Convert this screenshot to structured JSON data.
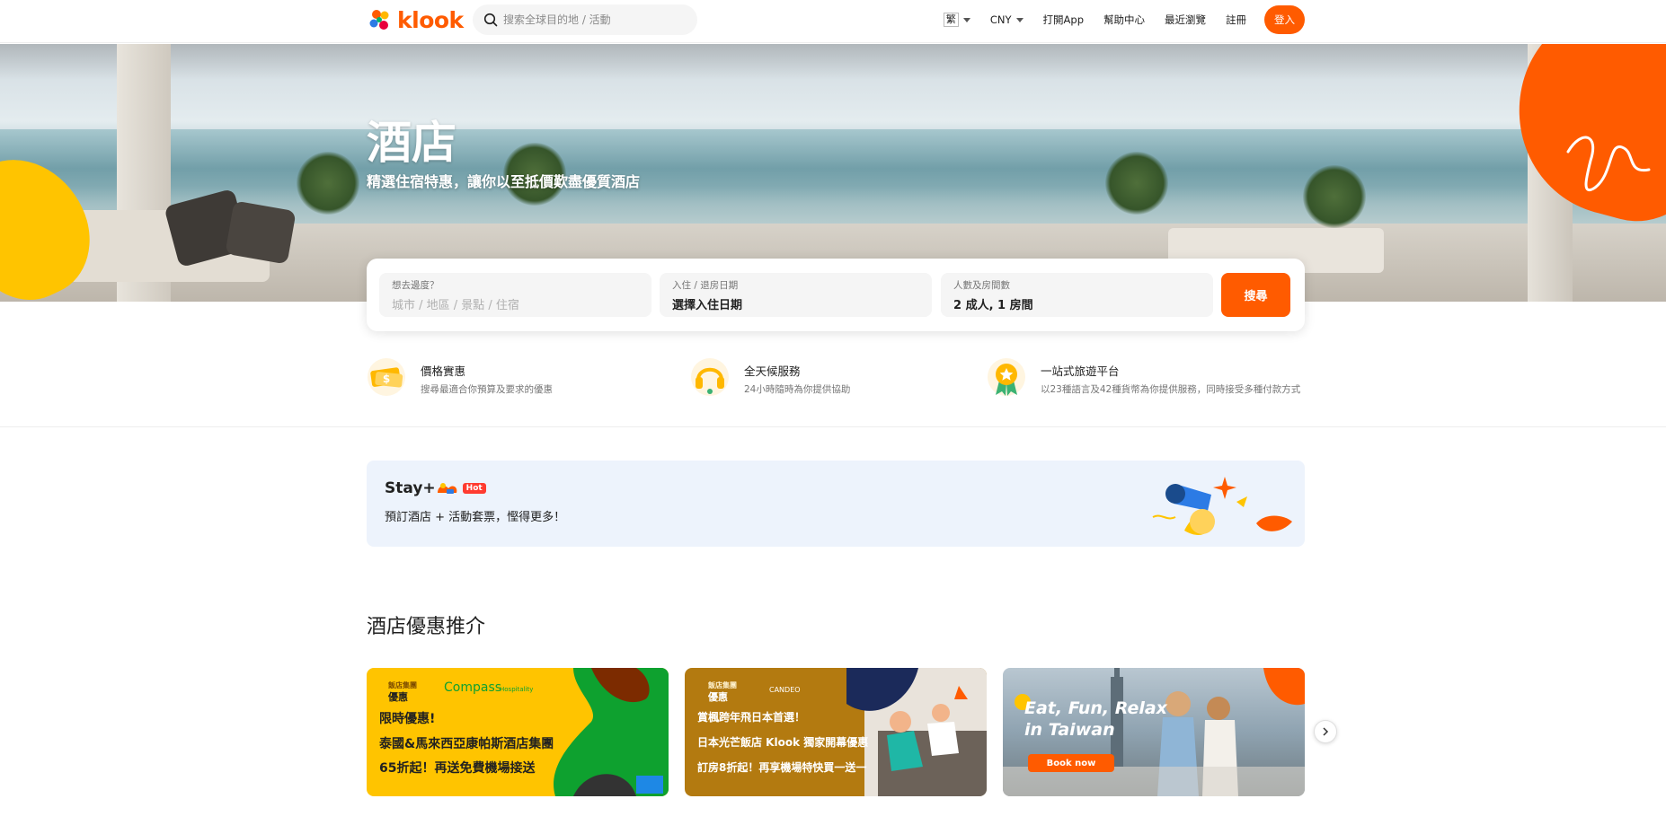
{
  "nav": {
    "logo_text": "klook",
    "search_placeholder": "搜索全球目的地 / 活動",
    "lang": "繁",
    "currency": "CNY",
    "open_app": "打開App",
    "help": "幫助中心",
    "recent": "最近瀏覽",
    "register": "註冊",
    "login": "登入"
  },
  "hero": {
    "title": "酒店",
    "subtitle": "精選住宿特惠，讓你以至抵價歎盡優質酒店"
  },
  "search": {
    "destination_label": "想去邊度？",
    "destination_placeholder": "城市 / 地區 / 景點 / 住宿",
    "dates_label": "入住 / 退房日期",
    "dates_value": "選擇入住日期",
    "guests_label": "人數及房間數",
    "guests_value": "2 成人, 1 房間",
    "button": "搜尋"
  },
  "features": [
    {
      "title": "價格實惠",
      "desc": "搜尋最適合你預算及要求的優惠"
    },
    {
      "title": "全天候服務",
      "desc": "24小時隨時為你提供協助"
    },
    {
      "title": "一站式旅遊平台",
      "desc": "以23種語言及42種貨幣為你提供服務，同時接受多種付款方式"
    }
  ],
  "stay": {
    "title": "Stay+",
    "badge": "Hot",
    "subtitle": "預訂酒店 + 活動套票，慳得更多！"
  },
  "section_title": "酒店優惠推介",
  "cards": [
    {
      "tag_top": "飯店集團",
      "tag_main": "優惠",
      "brand": "Compass",
      "brand_sub": "Hospitality",
      "line1": "限時優惠!",
      "line2": "泰國&馬來西亞康帕斯酒店集團",
      "line3": "65折起！再送免費機場接送"
    },
    {
      "tag_top": "飯店集團",
      "tag_main": "優惠",
      "brand": "CANDEO",
      "line1": "賞楓跨年飛日本首選！",
      "line2": "日本光芒飯店 Klook 獨家開幕優惠",
      "line3": "訂房8折起！再享機場特快買一送一"
    },
    {
      "line1": "Eat, Fun, Relax",
      "line2": "in Taiwan",
      "button": "Book now"
    }
  ],
  "colors": {
    "brand_orange": "#ff5b00",
    "yellow": "#ffc400",
    "green": "#0ea12f",
    "gold": "#b37a10"
  }
}
